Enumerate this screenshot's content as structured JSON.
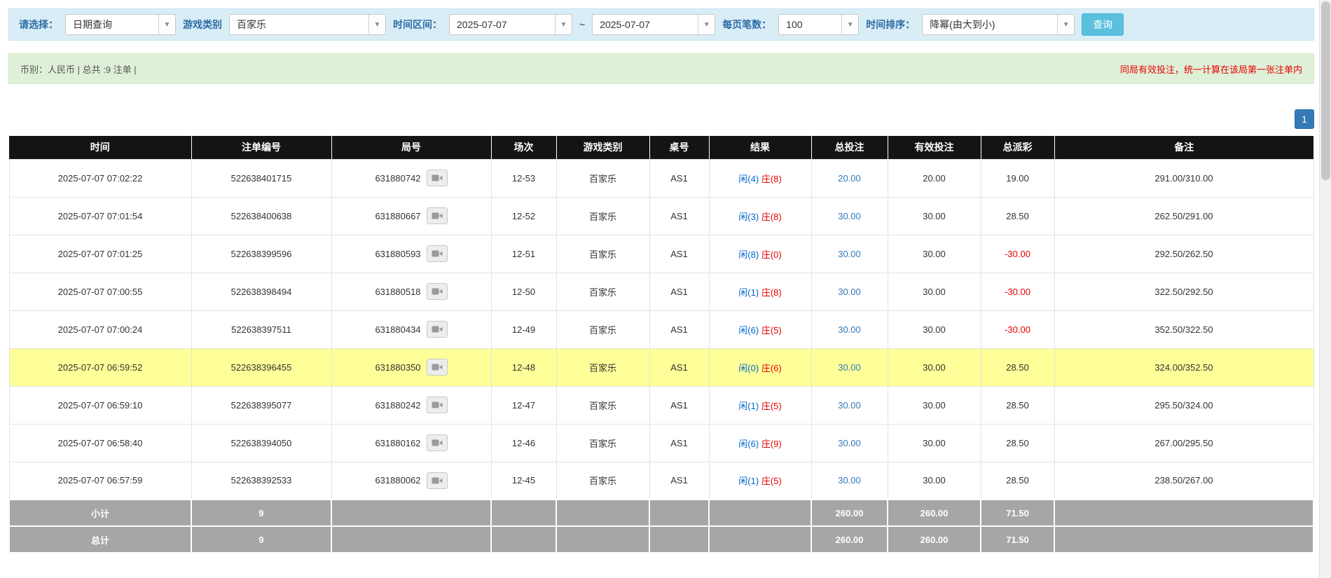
{
  "filters": {
    "select_label": "请选择：",
    "select_value": "日期查询",
    "game_label": "游戏类别",
    "game_value": "百家乐",
    "range_label": "时间区间：",
    "date_from": "2025-07-07",
    "range_sep": "~",
    "date_to": "2025-07-07",
    "page_size_label": "每页笔数：",
    "page_size_value": "100",
    "sort_label": "时间排序：",
    "sort_value": "降幂(由大到小)",
    "query_button": "查询"
  },
  "summary": {
    "currency_info": "币别：人民币 | 总共 :9 注单 |",
    "notice": "同局有效投注，统一计算在该局第一张注单内"
  },
  "pagination": {
    "current_page": "1"
  },
  "table": {
    "headers": [
      "时间",
      "注单编号",
      "局号",
      "场次",
      "游戏类别",
      "桌号",
      "结果",
      "总投注",
      "有效投注",
      "总派彩",
      "备注"
    ],
    "rows": [
      {
        "time": "2025-07-07 07:02:22",
        "bet_id": "522638401715",
        "round_id": "631880742",
        "session": "12-53",
        "game": "百家乐",
        "table_no": "AS1",
        "result_player": "闲(4)",
        "result_banker": "庄(8)",
        "total_bet": "20.00",
        "valid_bet": "20.00",
        "payout": "19.00",
        "note": "291.00/310.00",
        "highlight": false
      },
      {
        "time": "2025-07-07 07:01:54",
        "bet_id": "522638400638",
        "round_id": "631880667",
        "session": "12-52",
        "game": "百家乐",
        "table_no": "AS1",
        "result_player": "闲(3)",
        "result_banker": "庄(8)",
        "total_bet": "30.00",
        "valid_bet": "30.00",
        "payout": "28.50",
        "note": "262.50/291.00",
        "highlight": false
      },
      {
        "time": "2025-07-07 07:01:25",
        "bet_id": "522638399596",
        "round_id": "631880593",
        "session": "12-51",
        "game": "百家乐",
        "table_no": "AS1",
        "result_player": "闲(8)",
        "result_banker": "庄(0)",
        "total_bet": "30.00",
        "valid_bet": "30.00",
        "payout": "-30.00",
        "note": "292.50/262.50",
        "highlight": false
      },
      {
        "time": "2025-07-07 07:00:55",
        "bet_id": "522638398494",
        "round_id": "631880518",
        "session": "12-50",
        "game": "百家乐",
        "table_no": "AS1",
        "result_player": "闲(1)",
        "result_banker": "庄(8)",
        "total_bet": "30.00",
        "valid_bet": "30.00",
        "payout": "-30.00",
        "note": "322.50/292.50",
        "highlight": false
      },
      {
        "time": "2025-07-07 07:00:24",
        "bet_id": "522638397511",
        "round_id": "631880434",
        "session": "12-49",
        "game": "百家乐",
        "table_no": "AS1",
        "result_player": "闲(6)",
        "result_banker": "庄(5)",
        "total_bet": "30.00",
        "valid_bet": "30.00",
        "payout": "-30.00",
        "note": "352.50/322.50",
        "highlight": false
      },
      {
        "time": "2025-07-07 06:59:52",
        "bet_id": "522638396455",
        "round_id": "631880350",
        "session": "12-48",
        "game": "百家乐",
        "table_no": "AS1",
        "result_player": "闲(0)",
        "result_banker": "庄(6)",
        "total_bet": "30.00",
        "valid_bet": "30.00",
        "payout": "28.50",
        "note": "324.00/352.50",
        "highlight": true
      },
      {
        "time": "2025-07-07 06:59:10",
        "bet_id": "522638395077",
        "round_id": "631880242",
        "session": "12-47",
        "game": "百家乐",
        "table_no": "AS1",
        "result_player": "闲(1)",
        "result_banker": "庄(5)",
        "total_bet": "30.00",
        "valid_bet": "30.00",
        "payout": "28.50",
        "note": "295.50/324.00",
        "highlight": false
      },
      {
        "time": "2025-07-07 06:58:40",
        "bet_id": "522638394050",
        "round_id": "631880162",
        "session": "12-46",
        "game": "百家乐",
        "table_no": "AS1",
        "result_player": "闲(6)",
        "result_banker": "庄(9)",
        "total_bet": "30.00",
        "valid_bet": "30.00",
        "payout": "28.50",
        "note": "267.00/295.50",
        "highlight": false
      },
      {
        "time": "2025-07-07 06:57:59",
        "bet_id": "522638392533",
        "round_id": "631880062",
        "session": "12-45",
        "game": "百家乐",
        "table_no": "AS1",
        "result_player": "闲(1)",
        "result_banker": "庄(5)",
        "total_bet": "30.00",
        "valid_bet": "30.00",
        "payout": "28.50",
        "note": "238.50/267.00",
        "highlight": false
      }
    ],
    "subtotal": {
      "label": "小计",
      "count": "9",
      "total_bet": "260.00",
      "valid_bet": "260.00",
      "payout": "71.50"
    },
    "total": {
      "label": "总计",
      "count": "9",
      "total_bet": "260.00",
      "valid_bet": "260.00",
      "payout": "71.50"
    }
  },
  "colors": {
    "accent_blue": "#337ab7",
    "player_blue": "#0066cc",
    "banker_red": "#e60000",
    "negative_red": "#e60000",
    "highlight_yellow": "#ffff99",
    "filter_bar_bg": "#d9edf7",
    "summary_bar_bg": "#dff0d8",
    "header_bg": "#141414",
    "footer_bg": "#a6a6a6"
  }
}
